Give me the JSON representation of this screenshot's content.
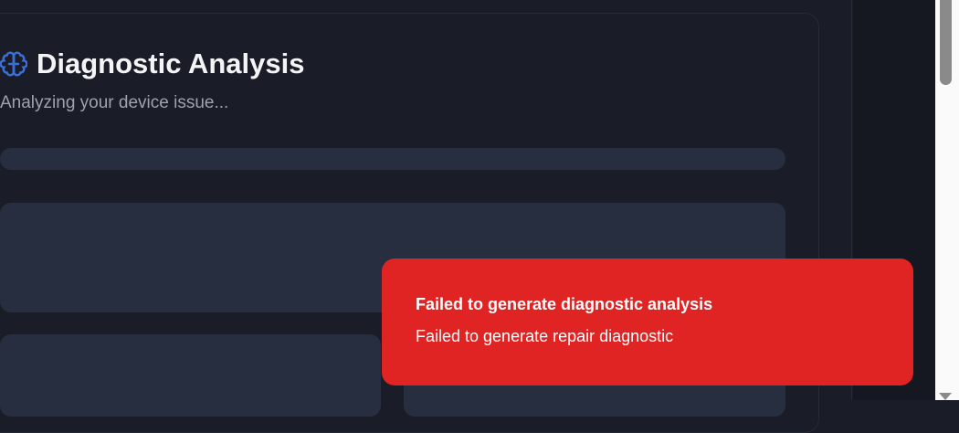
{
  "header": {
    "title": "Diagnostic Analysis",
    "subtitle": "Analyzing your device issue...",
    "icon": "brain-icon",
    "icon_color": "#3b6fd8"
  },
  "toast": {
    "title": "Failed to generate diagnostic analysis",
    "description": "Failed to generate repair diagnostic",
    "color": "#e02424"
  }
}
